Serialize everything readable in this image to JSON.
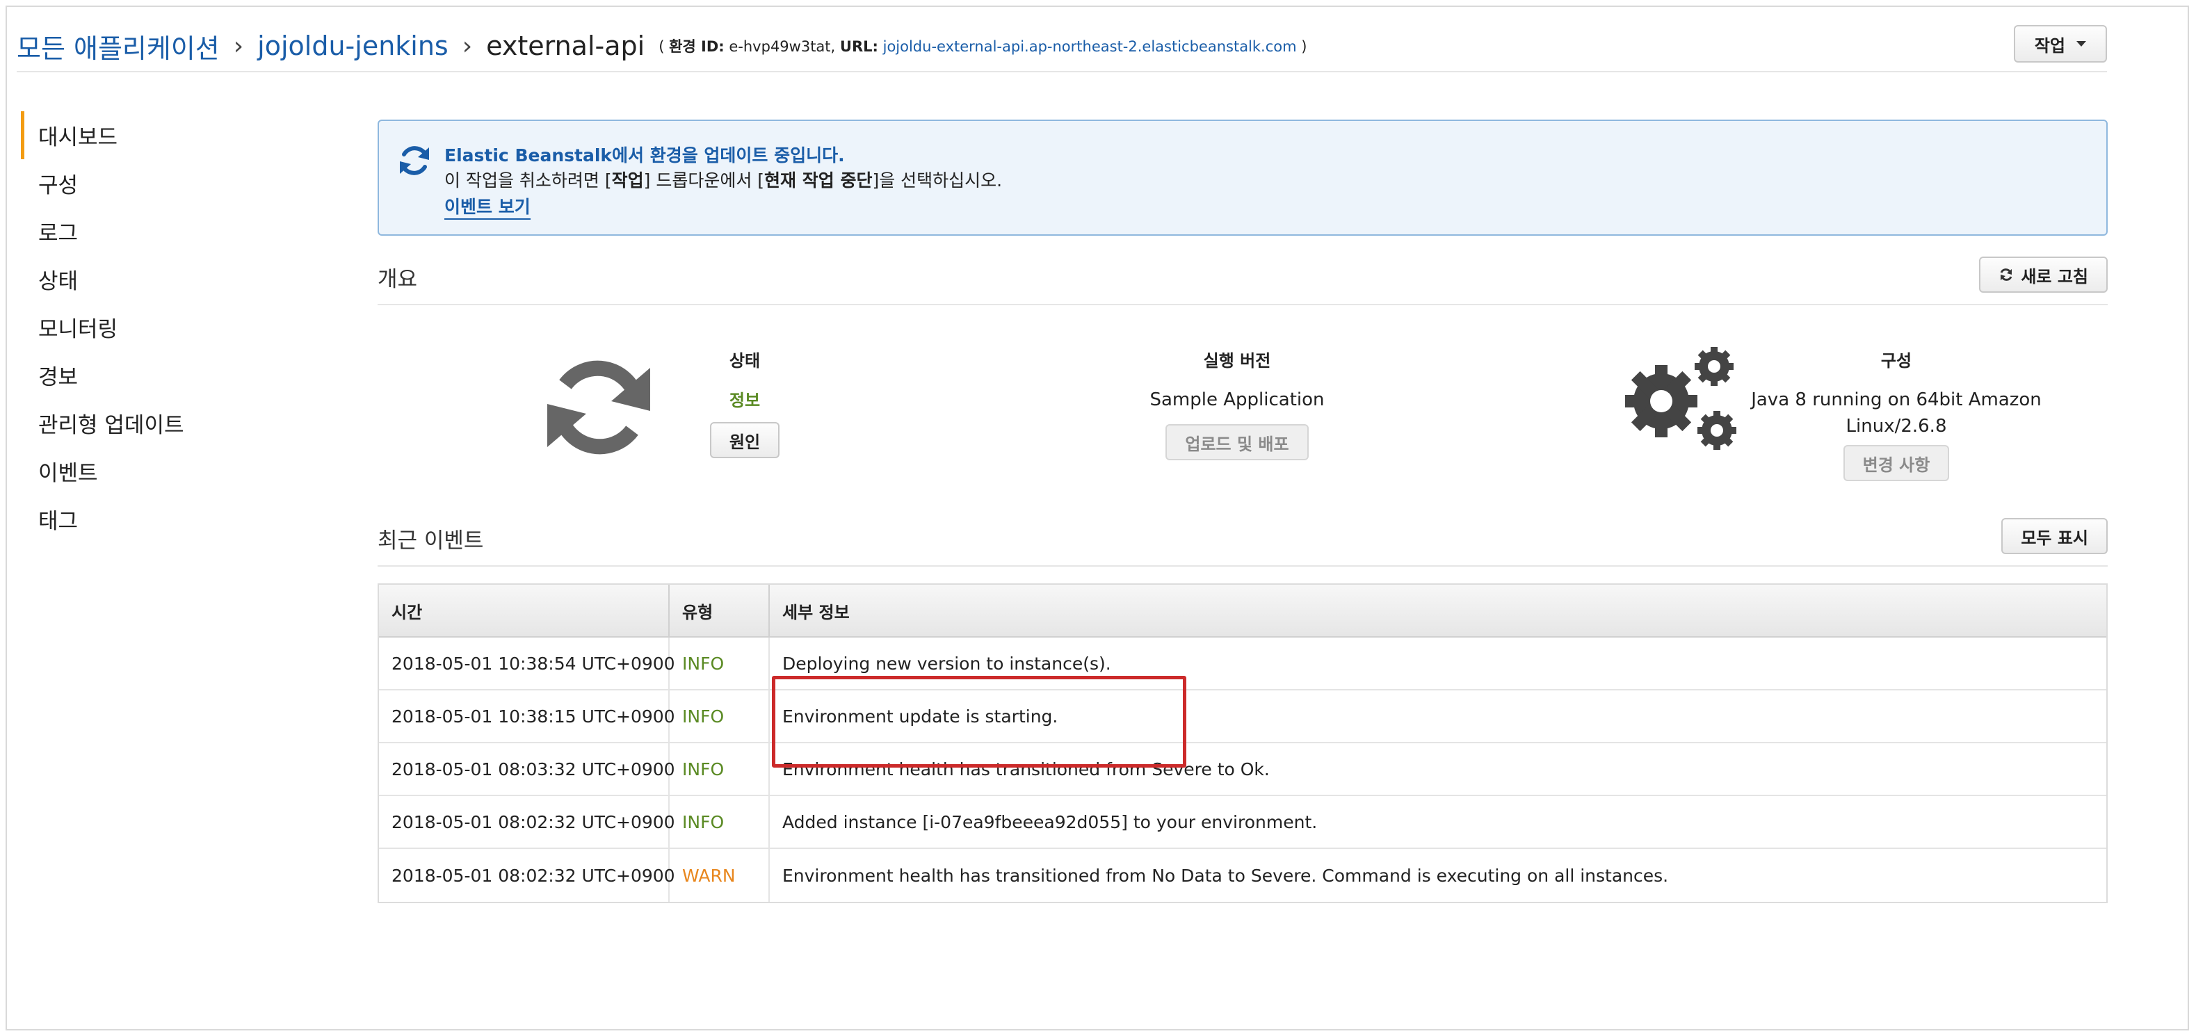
{
  "breadcrumb": {
    "all_apps": "모든 애플리케이션",
    "app": "jojoldu-jenkins",
    "env": "external-api",
    "meta_open": "(",
    "env_id_label": "환경 ID:",
    "env_id": "e-hvp49w3tat,",
    "url_label": "URL:",
    "url": "jojoldu-external-api.ap-northeast-2.elasticbeanstalk.com",
    "meta_close": ")",
    "sep": "›"
  },
  "actions_button": "작업",
  "sidebar": {
    "items": [
      {
        "label": "대시보드",
        "active": true
      },
      {
        "label": "구성"
      },
      {
        "label": "로그"
      },
      {
        "label": "상태"
      },
      {
        "label": "모니터링"
      },
      {
        "label": "경보"
      },
      {
        "label": "관리형 업데이트"
      },
      {
        "label": "이벤트"
      },
      {
        "label": "태그"
      }
    ]
  },
  "alert": {
    "title": "Elastic Beanstalk에서 환경을 업데이트 중입니다.",
    "body_pre": "이 작업을 취소하려면 [",
    "body_b1": "작업",
    "body_mid": "] 드롭다운에서 [",
    "body_b2": "현재 작업 중단",
    "body_post": "]을 선택하십시오.",
    "link": "이벤트 보기"
  },
  "overview": {
    "title": "개요",
    "refresh_button": "새로 고침",
    "status_label": "상태",
    "status_value": "정보",
    "status_button": "원인",
    "version_label": "실행 버전",
    "version_value": "Sample Application",
    "version_button": "업로드 및 배포",
    "config_label": "구성",
    "config_value_line1": "Java 8 running on 64bit Amazon",
    "config_value_line2": "Linux/2.6.8",
    "config_button": "변경 사항"
  },
  "events": {
    "title": "최근 이벤트",
    "show_all_button": "모두 표시",
    "headers": {
      "time": "시간",
      "type": "유형",
      "detail": "세부 정보"
    },
    "rows": [
      {
        "time": "2018-05-01 10:38:54 UTC+0900",
        "type": "INFO",
        "detail": "Deploying new version to instance(s)."
      },
      {
        "time": "2018-05-01 10:38:15 UTC+0900",
        "type": "INFO",
        "detail": "Environment update is starting."
      },
      {
        "time": "2018-05-01 08:03:32 UTC+0900",
        "type": "INFO",
        "detail": "Environment health has transitioned from Severe to Ok."
      },
      {
        "time": "2018-05-01 08:02:32 UTC+0900",
        "type": "INFO",
        "detail": "Added instance [i-07ea9fbeeea92d055] to your environment."
      },
      {
        "time": "2018-05-01 08:02:32 UTC+0900",
        "type": "WARN",
        "detail": "Environment health has transitioned from No Data to Severe. Command is executing on all instances."
      }
    ]
  },
  "colors": {
    "link": "#1a5da8",
    "info": "#5a8a23",
    "warn": "#e8871e",
    "active_marker": "#f39c12",
    "annotation": "#cc2a2a"
  },
  "icons": {
    "alert": "refresh-icon",
    "status": "refresh-large-icon",
    "config": "gears-icon"
  }
}
